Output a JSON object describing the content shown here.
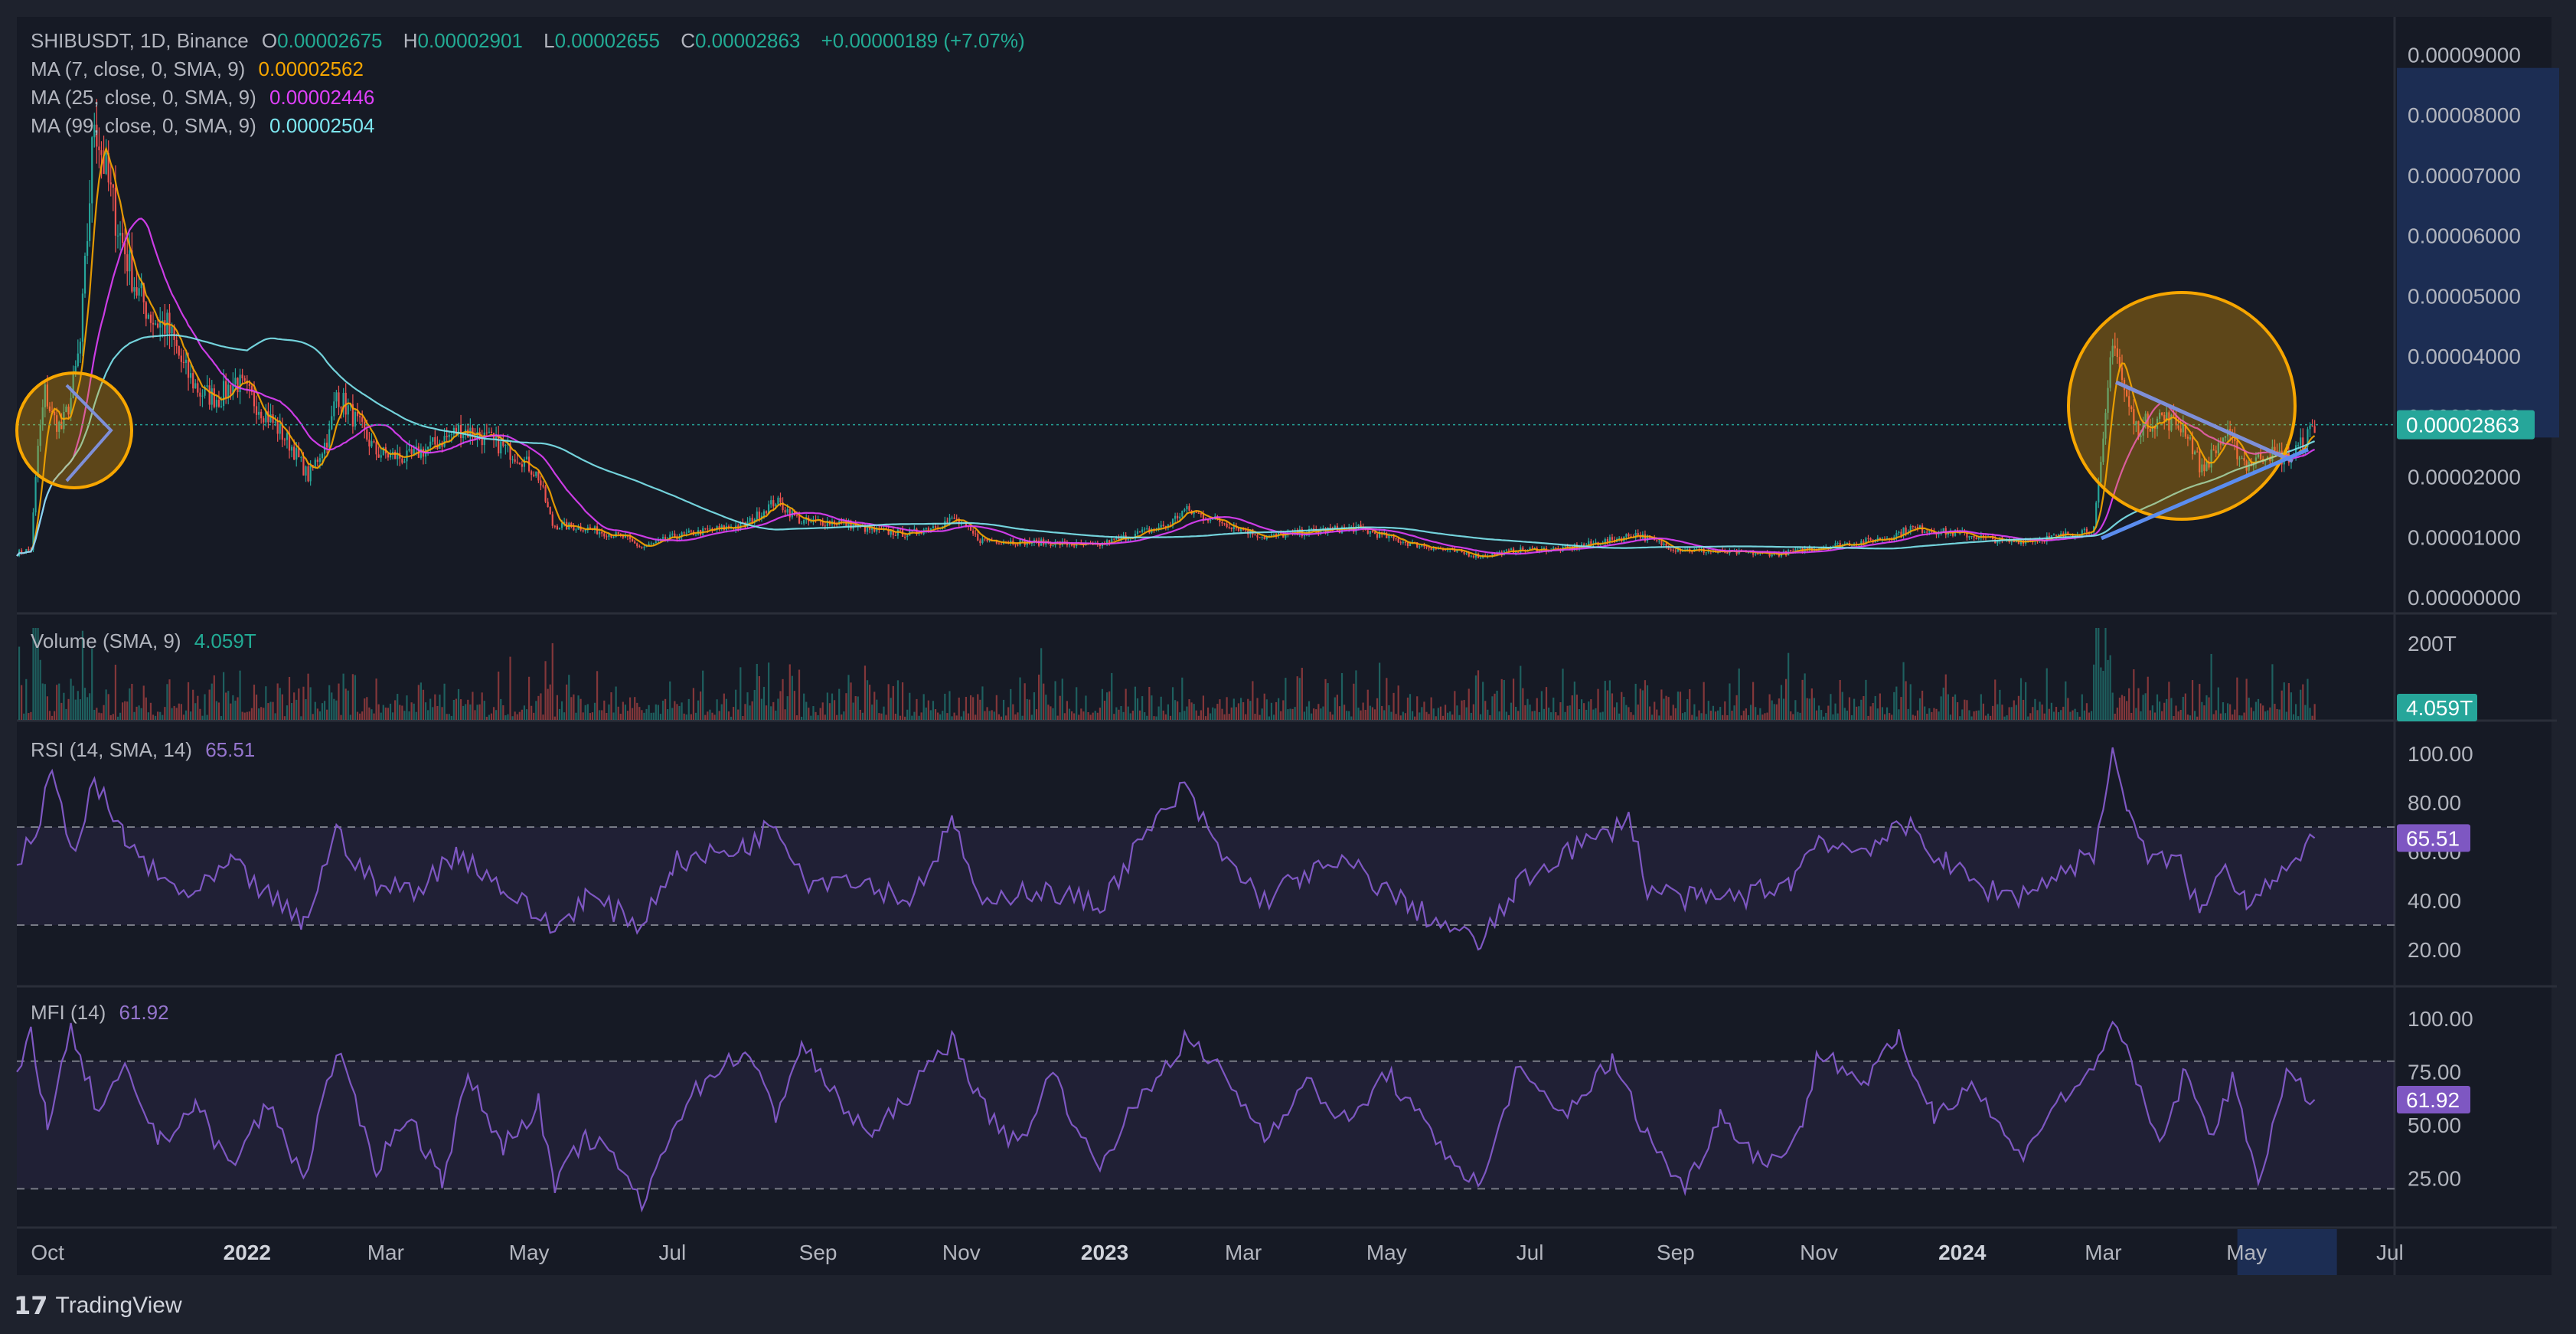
{
  "header": {
    "symbol": "SHIBUSDT, 1D, Binance",
    "open_label": "O",
    "open": "0.00002675",
    "high_label": "H",
    "high": "0.00002901",
    "low_label": "L",
    "low": "0.00002655",
    "close_label": "C",
    "close": "0.00002863",
    "change": "+0.00000189 (+7.07%)",
    "up_color": "#22ab94"
  },
  "indicators": {
    "ma7": {
      "label": "MA (7, close, 0, SMA, 9)",
      "value": "0.00002562",
      "color": "#f7a600"
    },
    "ma25": {
      "label": "MA (25, close, 0, SMA, 9)",
      "value": "0.00002446",
      "color": "#e040fb"
    },
    "ma99": {
      "label": "MA (99, close, 0, SMA, 9)",
      "value": "0.00002504",
      "color": "#7de7f0"
    },
    "volume": {
      "label": "Volume (SMA, 9)",
      "value": "4.059T",
      "color": "#22ab94"
    },
    "rsi": {
      "label": "RSI (14, SMA, 14)",
      "value": "65.51",
      "color": "#7e57c2"
    },
    "mfi": {
      "label": "MFI (14)",
      "value": "61.92",
      "color": "#7e57c2"
    }
  },
  "footer": {
    "brand": "TradingView"
  },
  "chart_data": [
    {
      "type": "candlestick",
      "pane": "price",
      "y_ticks": [
        "0.00000000",
        "0.00001000",
        "0.00002000",
        "0.00003000",
        "0.00004000",
        "0.00005000",
        "0.00006000",
        "0.00007000",
        "0.00008000",
        "0.00009000"
      ],
      "ylim": [
        0,
        9.5e-05
      ],
      "last_price": "0.00002863",
      "x_ticks": [
        "Oct",
        "2022",
        "Mar",
        "May",
        "Jul",
        "Sep",
        "Nov",
        "2023",
        "Mar",
        "May",
        "Jul",
        "Sep",
        "Nov",
        "2024",
        "Mar",
        "May",
        "Jul"
      ],
      "x_range": [
        "2021-09-25",
        "2024-07-03"
      ],
      "price_path": [
        [
          "2021-09-25",
          7.3e-06
        ],
        [
          "2021-10-01",
          8e-06
        ],
        [
          "2021-10-04",
          2.5e-05
        ],
        [
          "2021-10-07",
          3.4e-05
        ],
        [
          "2021-10-10",
          3e-05
        ],
        [
          "2021-10-14",
          2.8e-05
        ],
        [
          "2021-10-18",
          3.3e-05
        ],
        [
          "2021-10-22",
          4.2e-05
        ],
        [
          "2021-10-25",
          6e-05
        ],
        [
          "2021-10-28",
          8e-05
        ],
        [
          "2021-11-02",
          7e-05
        ],
        [
          "2021-11-08",
          6e-05
        ],
        [
          "2021-11-15",
          5.1e-05
        ],
        [
          "2021-11-22",
          4.6e-05
        ],
        [
          "2021-11-28",
          4.5e-05
        ],
        [
          "2021-12-05",
          3.8e-05
        ],
        [
          "2021-12-12",
          3.4e-05
        ],
        [
          "2021-12-20",
          3.3e-05
        ],
        [
          "2021-12-27",
          3.6e-05
        ],
        [
          "2022-01-03",
          3.3e-05
        ],
        [
          "2022-01-10",
          3e-05
        ],
        [
          "2022-01-20",
          2.5e-05
        ],
        [
          "2022-01-27",
          2e-05
        ],
        [
          "2022-02-05",
          2.7e-05
        ],
        [
          "2022-02-08",
          3.4e-05
        ],
        [
          "2022-02-15",
          3e-05
        ],
        [
          "2022-02-25",
          2.4e-05
        ],
        [
          "2022-03-10",
          2.3e-05
        ],
        [
          "2022-03-25",
          2.6e-05
        ],
        [
          "2022-04-02",
          2.8e-05
        ],
        [
          "2022-04-15",
          2.6e-05
        ],
        [
          "2022-04-28",
          2.3e-05
        ],
        [
          "2022-05-05",
          2e-05
        ],
        [
          "2022-05-11",
          1.2e-05
        ],
        [
          "2022-05-25",
          1.15e-05
        ],
        [
          "2022-06-10",
          1e-05
        ],
        [
          "2022-06-18",
          8.2e-06
        ],
        [
          "2022-07-01",
          1e-05
        ],
        [
          "2022-07-15",
          1.1e-05
        ],
        [
          "2022-08-01",
          1.2e-05
        ],
        [
          "2022-08-14",
          1.6e-05
        ],
        [
          "2022-08-25",
          1.25e-05
        ],
        [
          "2022-09-10",
          1.25e-05
        ],
        [
          "2022-09-25",
          1.1e-05
        ],
        [
          "2022-10-10",
          1.05e-05
        ],
        [
          "2022-10-29",
          1.3e-05
        ],
        [
          "2022-11-09",
          9.5e-06
        ],
        [
          "2022-11-25",
          9.2e-06
        ],
        [
          "2022-12-10",
          9e-06
        ],
        [
          "2022-12-28",
          8.5e-06
        ],
        [
          "2023-01-10",
          1e-05
        ],
        [
          "2023-01-28",
          1.2e-05
        ],
        [
          "2023-02-04",
          1.45e-05
        ],
        [
          "2023-02-20",
          1.25e-05
        ],
        [
          "2023-03-10",
          1e-05
        ],
        [
          "2023-04-01",
          1.1e-05
        ],
        [
          "2023-04-18",
          1.15e-05
        ],
        [
          "2023-05-10",
          9e-06
        ],
        [
          "2023-06-10",
          6.8e-06
        ],
        [
          "2023-06-25",
          7.8e-06
        ],
        [
          "2023-07-15",
          8e-06
        ],
        [
          "2023-08-05",
          9.5e-06
        ],
        [
          "2023-08-15",
          1.05e-05
        ],
        [
          "2023-09-01",
          8e-06
        ],
        [
          "2023-09-20",
          7.5e-06
        ],
        [
          "2023-10-15",
          7.2e-06
        ],
        [
          "2023-11-05",
          8.5e-06
        ],
        [
          "2023-11-20",
          9.2e-06
        ],
        [
          "2023-12-01",
          1e-05
        ],
        [
          "2023-12-10",
          1.15e-05
        ],
        [
          "2024-01-01",
          1.05e-05
        ],
        [
          "2024-01-20",
          9.2e-06
        ],
        [
          "2024-02-10",
          1e-05
        ],
        [
          "2024-02-26",
          1.15e-05
        ],
        [
          "2024-03-01",
          2.5e-05
        ],
        [
          "2024-03-05",
          4.4e-05
        ],
        [
          "2024-03-10",
          3.4e-05
        ],
        [
          "2024-03-15",
          2.8e-05
        ],
        [
          "2024-03-25",
          3e-05
        ],
        [
          "2024-04-05",
          2.8e-05
        ],
        [
          "2024-04-12",
          2.1e-05
        ],
        [
          "2024-04-22",
          2.7e-05
        ],
        [
          "2024-05-01",
          2.2e-05
        ],
        [
          "2024-05-10",
          2.4e-05
        ],
        [
          "2024-05-18",
          2.3e-05
        ],
        [
          "2024-05-25",
          2.55e-05
        ],
        [
          "2024-05-30",
          2.86e-05
        ]
      ]
    },
    {
      "type": "bar",
      "pane": "volume",
      "y_ticks": [
        "200T"
      ],
      "last_value": "4.059T"
    },
    {
      "type": "line",
      "pane": "rsi",
      "y_ticks": [
        "20.00",
        "40.00",
        "60.00",
        "80.00",
        "100.00"
      ],
      "ylim": [
        10,
        105
      ],
      "bands": [
        30,
        70
      ],
      "last_value": "65.51",
      "points": [
        [
          "2021-09-25",
          52
        ],
        [
          "2021-10-05",
          75
        ],
        [
          "2021-10-10",
          90
        ],
        [
          "2021-10-20",
          60
        ],
        [
          "2021-10-28",
          88
        ],
        [
          "2021-11-10",
          65
        ],
        [
          "2021-11-25",
          48
        ],
        [
          "2021-12-10",
          42
        ],
        [
          "2021-12-25",
          55
        ],
        [
          "2022-01-10",
          42
        ],
        [
          "2022-01-25",
          30
        ],
        [
          "2022-02-08",
          68
        ],
        [
          "2022-02-25",
          45
        ],
        [
          "2022-03-15",
          45
        ],
        [
          "2022-04-01",
          60
        ],
        [
          "2022-04-20",
          45
        ],
        [
          "2022-05-12",
          28
        ],
        [
          "2022-05-25",
          42
        ],
        [
          "2022-06-18",
          30
        ],
        [
          "2022-07-01",
          55
        ],
        [
          "2022-07-15",
          58
        ],
        [
          "2022-08-01",
          62
        ],
        [
          "2022-08-14",
          72
        ],
        [
          "2022-08-28",
          48
        ],
        [
          "2022-09-15",
          50
        ],
        [
          "2022-10-10",
          40
        ],
        [
          "2022-10-29",
          72
        ],
        [
          "2022-11-10",
          35
        ],
        [
          "2022-11-25",
          45
        ],
        [
          "2022-12-15",
          42
        ],
        [
          "2022-12-30",
          38
        ],
        [
          "2023-01-15",
          62
        ],
        [
          "2023-02-04",
          86
        ],
        [
          "2023-02-20",
          58
        ],
        [
          "2023-03-10",
          40
        ],
        [
          "2023-03-25",
          50
        ],
        [
          "2023-04-15",
          55
        ],
        [
          "2023-05-10",
          38
        ],
        [
          "2023-06-10",
          22
        ],
        [
          "2023-06-25",
          45
        ],
        [
          "2023-07-15",
          60
        ],
        [
          "2023-08-01",
          66
        ],
        [
          "2023-08-12",
          75
        ],
        [
          "2023-08-20",
          45
        ],
        [
          "2023-09-10",
          40
        ],
        [
          "2023-10-01",
          42
        ],
        [
          "2023-10-20",
          48
        ],
        [
          "2023-11-01",
          66
        ],
        [
          "2023-11-15",
          60
        ],
        [
          "2023-11-28",
          65
        ],
        [
          "2023-12-10",
          70
        ],
        [
          "2023-12-25",
          55
        ],
        [
          "2024-01-10",
          45
        ],
        [
          "2024-01-25",
          42
        ],
        [
          "2024-02-10",
          50
        ],
        [
          "2024-02-26",
          60
        ],
        [
          "2024-03-05",
          98
        ],
        [
          "2024-03-12",
          78
        ],
        [
          "2024-03-20",
          55
        ],
        [
          "2024-04-01",
          58
        ],
        [
          "2024-04-12",
          35
        ],
        [
          "2024-04-22",
          55
        ],
        [
          "2024-05-01",
          40
        ],
        [
          "2024-05-12",
          50
        ],
        [
          "2024-05-22",
          55
        ],
        [
          "2024-05-30",
          65.51
        ]
      ]
    },
    {
      "type": "line",
      "pane": "mfi",
      "y_ticks": [
        "25.00",
        "50.00",
        "75.00",
        "100.00"
      ],
      "ylim": [
        5,
        108
      ],
      "bands": [
        20,
        80
      ],
      "last_value": "61.92",
      "points": [
        [
          "2021-09-25",
          70
        ],
        [
          "2021-10-01",
          95
        ],
        [
          "2021-10-08",
          50
        ],
        [
          "2021-10-18",
          93
        ],
        [
          "2021-10-30",
          55
        ],
        [
          "2021-11-10",
          75
        ],
        [
          "2021-11-25",
          42
        ],
        [
          "2021-12-10",
          60
        ],
        [
          "2021-12-25",
          30
        ],
        [
          "2022-01-10",
          60
        ],
        [
          "2022-01-25",
          25
        ],
        [
          "2022-02-08",
          85
        ],
        [
          "2022-02-25",
          30
        ],
        [
          "2022-03-10",
          55
        ],
        [
          "2022-03-25",
          25
        ],
        [
          "2022-04-05",
          72
        ],
        [
          "2022-04-20",
          40
        ],
        [
          "2022-05-05",
          60
        ],
        [
          "2022-05-12",
          20
        ],
        [
          "2022-05-25",
          45
        ],
        [
          "2022-06-10",
          30
        ],
        [
          "2022-06-18",
          10
        ],
        [
          "2022-07-01",
          50
        ],
        [
          "2022-07-15",
          72
        ],
        [
          "2022-08-01",
          85
        ],
        [
          "2022-08-14",
          55
        ],
        [
          "2022-08-25",
          88
        ],
        [
          "2022-09-10",
          60
        ],
        [
          "2022-09-25",
          45
        ],
        [
          "2022-10-10",
          65
        ],
        [
          "2022-10-29",
          92
        ],
        [
          "2022-11-09",
          60
        ],
        [
          "2022-11-25",
          40
        ],
        [
          "2022-12-10",
          75
        ],
        [
          "2022-12-28",
          30
        ],
        [
          "2023-01-15",
          60
        ],
        [
          "2023-02-04",
          90
        ],
        [
          "2023-02-20",
          75
        ],
        [
          "2023-03-10",
          45
        ],
        [
          "2023-03-28",
          70
        ],
        [
          "2023-04-15",
          50
        ],
        [
          "2023-05-01",
          75
        ],
        [
          "2023-05-20",
          45
        ],
        [
          "2023-06-10",
          20
        ],
        [
          "2023-06-25",
          75
        ],
        [
          "2023-07-15",
          55
        ],
        [
          "2023-08-05",
          80
        ],
        [
          "2023-08-20",
          45
        ],
        [
          "2023-09-05",
          20
        ],
        [
          "2023-09-20",
          55
        ],
        [
          "2023-10-10",
          30
        ],
        [
          "2023-10-25",
          50
        ],
        [
          "2023-11-01",
          85
        ],
        [
          "2023-11-20",
          70
        ],
        [
          "2023-12-05",
          90
        ],
        [
          "2023-12-20",
          55
        ],
        [
          "2024-01-05",
          70
        ],
        [
          "2024-01-25",
          35
        ],
        [
          "2024-02-10",
          60
        ],
        [
          "2024-02-26",
          75
        ],
        [
          "2024-03-05",
          102
        ],
        [
          "2024-03-15",
          70
        ],
        [
          "2024-03-25",
          40
        ],
        [
          "2024-04-05",
          75
        ],
        [
          "2024-04-15",
          45
        ],
        [
          "2024-04-25",
          70
        ],
        [
          "2024-05-06",
          25
        ],
        [
          "2024-05-18",
          72
        ],
        [
          "2024-05-30",
          61.92
        ]
      ]
    }
  ]
}
